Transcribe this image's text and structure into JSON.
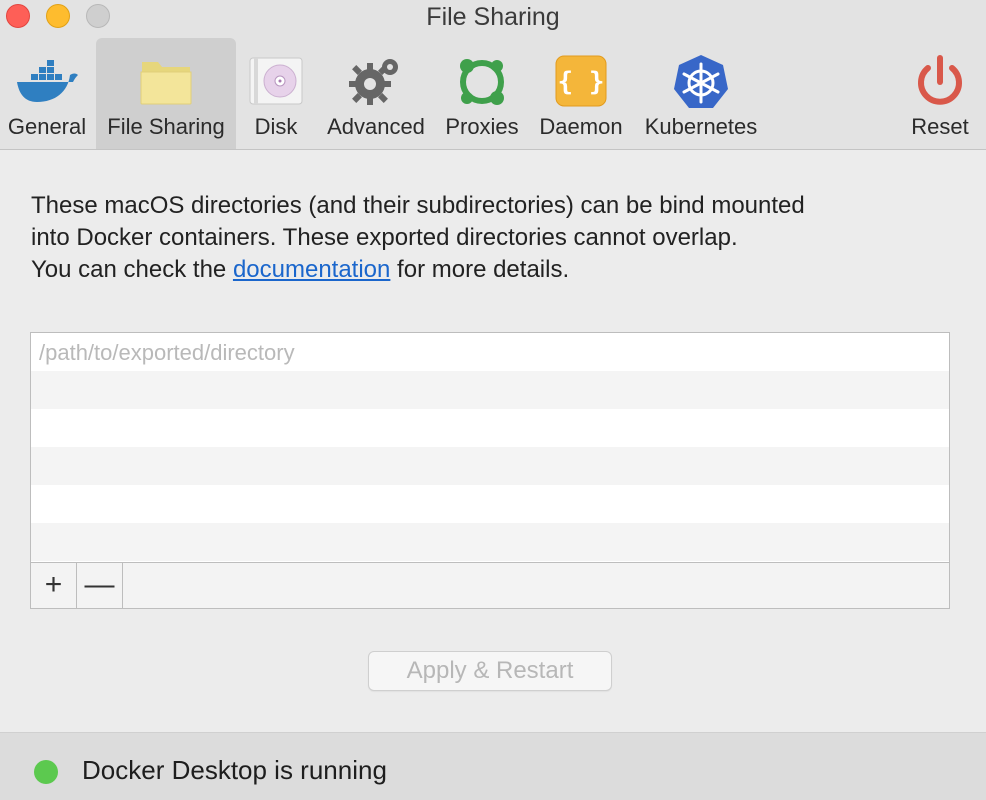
{
  "window": {
    "title": "File Sharing"
  },
  "toolbar": {
    "tabs": [
      {
        "label": "General",
        "icon": "docker-whale-icon"
      },
      {
        "label": "File Sharing",
        "icon": "folder-icon",
        "active": true
      },
      {
        "label": "Disk",
        "icon": "disk-icon"
      },
      {
        "label": "Advanced",
        "icon": "gear-icon"
      },
      {
        "label": "Proxies",
        "icon": "network-icon"
      },
      {
        "label": "Daemon",
        "icon": "braces-icon"
      },
      {
        "label": "Kubernetes",
        "icon": "kubernetes-helm-icon"
      },
      {
        "label": "Reset",
        "icon": "power-icon"
      }
    ]
  },
  "description": {
    "line1": "These macOS directories (and their subdirectories) can be bind mounted",
    "line2": "into Docker containers. These exported directories cannot overlap.",
    "line3_before": "You can check the ",
    "link": "documentation",
    "line3_after": " for more details."
  },
  "directories": {
    "placeholder": "/path/to/exported/directory",
    "add_label": "+",
    "remove_label": "—"
  },
  "actions": {
    "apply_label": "Apply & Restart"
  },
  "status": {
    "text": "Docker Desktop is running",
    "color": "#5cc94f"
  },
  "colors": {
    "link": "#1a66cc",
    "close": "#fe5f57",
    "minimize": "#febc2e",
    "zoom": "#cfcfcf"
  }
}
